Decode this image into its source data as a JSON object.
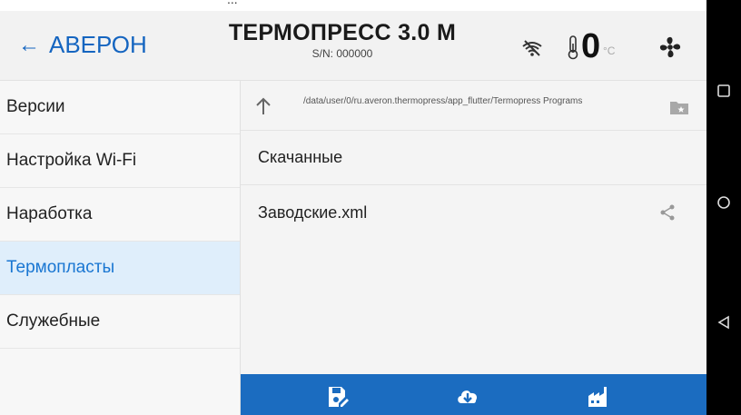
{
  "top_clip": "...",
  "header": {
    "back_label": "АВЕРОН",
    "title": "ТЕРМОПРЕСС 3.0 М",
    "serial": "S/N: 000000",
    "temperature": "0",
    "temperature_unit": "°C"
  },
  "sidebar": {
    "items": [
      {
        "label": "Версии"
      },
      {
        "label": "Настройка Wi-Fi"
      },
      {
        "label": "Наработка"
      },
      {
        "label": "Термопласты"
      },
      {
        "label": "Служебные"
      }
    ],
    "active": "Термопласты"
  },
  "content": {
    "path": "/data/user/0/ru.averon.thermopress/app_flutter/Termopress Programs",
    "files": [
      {
        "name": "Скачанные"
      },
      {
        "name": "Заводские.xml"
      }
    ]
  },
  "colors": {
    "accent": "#1976d2",
    "bottom_bar": "#1b6cc0",
    "active_bg": "#dfeefb"
  },
  "icons": {
    "back": "arrow-left-icon",
    "wifi": "wifi-off-icon",
    "thermo": "thermometer-icon",
    "fan": "fan-icon",
    "up": "arrow-up-icon",
    "folder": "folder-star-icon",
    "share": "share-icon",
    "bottom": [
      "save-edit-icon",
      "cloud-download-icon",
      "factory-icon"
    ],
    "nav": [
      "square-icon",
      "circle-icon",
      "triangle-back-icon"
    ]
  }
}
